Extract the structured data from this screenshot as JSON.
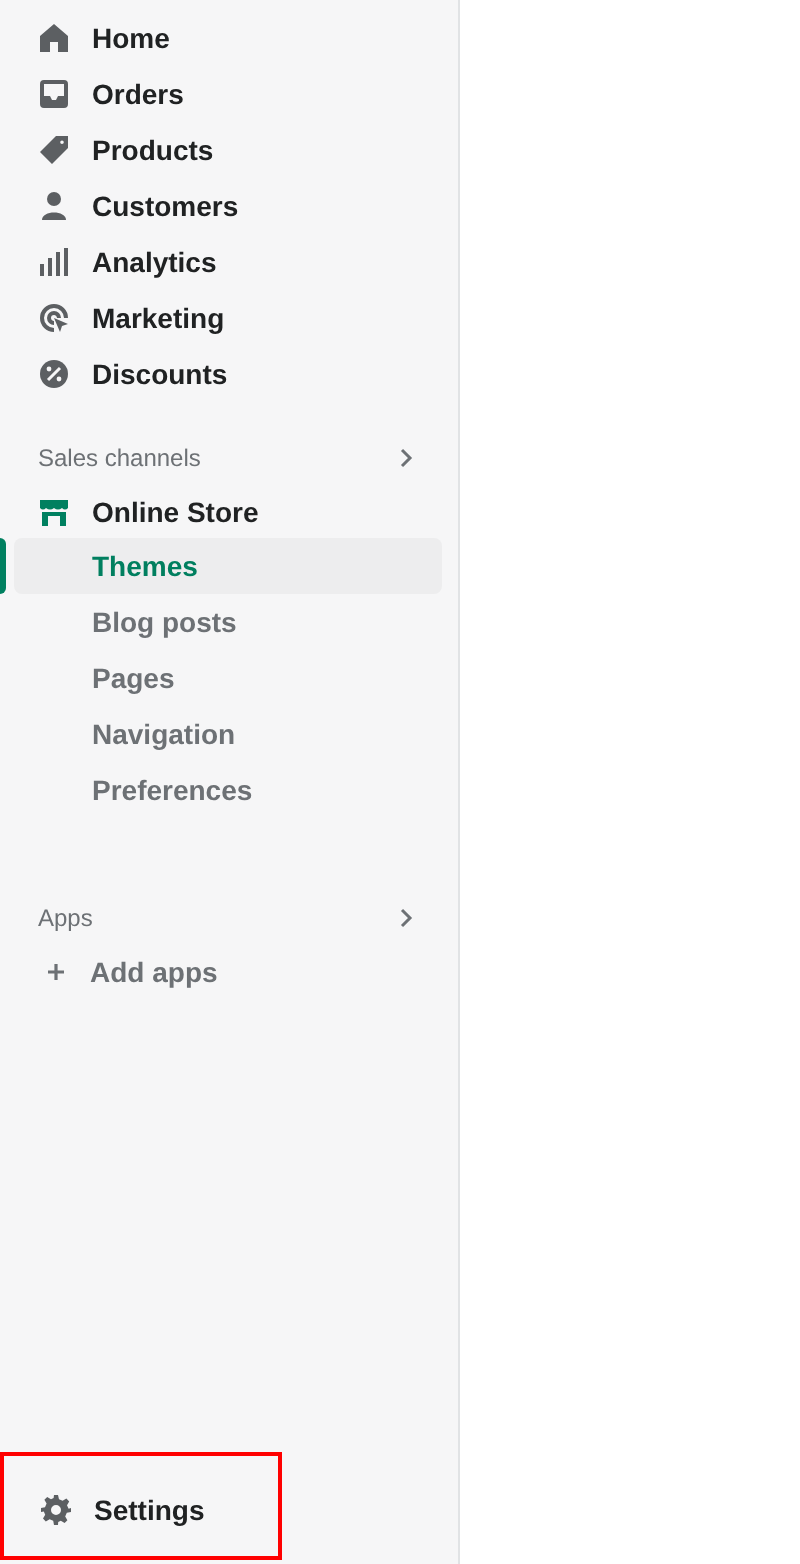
{
  "nav": [
    {
      "label": "Home",
      "kind": "home"
    },
    {
      "label": "Orders",
      "kind": "orders"
    },
    {
      "label": "Products",
      "kind": "products"
    },
    {
      "label": "Customers",
      "kind": "customers"
    },
    {
      "label": "Analytics",
      "kind": "analytics"
    },
    {
      "label": "Marketing",
      "kind": "marketing"
    },
    {
      "label": "Discounts",
      "kind": "discounts"
    }
  ],
  "sales_channels": {
    "heading": "Sales channels",
    "channel": {
      "label": "Online Store",
      "expanded": true
    },
    "items": [
      {
        "label": "Themes",
        "selected": true
      },
      {
        "label": "Blog posts",
        "selected": false
      },
      {
        "label": "Pages",
        "selected": false
      },
      {
        "label": "Navigation",
        "selected": false
      },
      {
        "label": "Preferences",
        "selected": false
      }
    ]
  },
  "apps": {
    "heading": "Apps",
    "add": "Add apps"
  },
  "settings": {
    "label": "Settings",
    "highlighted": true
  }
}
